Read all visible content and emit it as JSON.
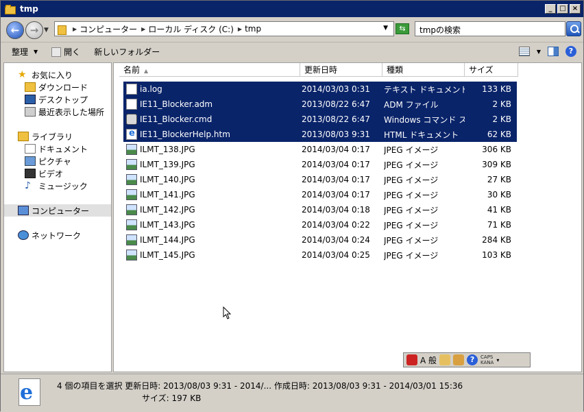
{
  "window": {
    "title": "tmp"
  },
  "address": {
    "crumbs": [
      "コンピューター",
      "ローカル ディスク (C:)",
      "tmp"
    ],
    "search_placeholder": "tmpの検索"
  },
  "toolbar": {
    "organize": "整理",
    "open": "開く",
    "new_folder": "新しいフォルダー"
  },
  "nav": {
    "favorites": "お気に入り",
    "downloads": "ダウンロード",
    "desktop": "デスクトップ",
    "recent": "最近表示した場所",
    "libraries": "ライブラリ",
    "documents": "ドキュメント",
    "pictures": "ピクチャ",
    "videos": "ビデオ",
    "music": "ミュージック",
    "computer": "コンピューター",
    "network": "ネットワーク"
  },
  "columns": {
    "name": "名前",
    "date": "更新日時",
    "type": "種類",
    "size": "サイズ"
  },
  "files": [
    {
      "name": "ia.log",
      "date": "2014/03/03 0:31",
      "type": "テキスト ドキュメント",
      "size": "133 KB",
      "icon": "text-file-icon",
      "selected": true
    },
    {
      "name": "IE11_Blocker.adm",
      "date": "2013/08/22 6:47",
      "type": "ADM ファイル",
      "size": "2 KB",
      "icon": "adm-file-icon",
      "selected": true
    },
    {
      "name": "IE11_Blocker.cmd",
      "date": "2013/08/22 6:47",
      "type": "Windows コマンド ス...",
      "size": "2 KB",
      "icon": "cmd-file-icon",
      "selected": true
    },
    {
      "name": "IE11_BlockerHelp.htm",
      "date": "2013/08/03 9:31",
      "type": "HTML ドキュメント",
      "size": "62 KB",
      "icon": "ie-html-icon",
      "selected": true
    },
    {
      "name": "ILMT_138.JPG",
      "date": "2014/03/04 0:17",
      "type": "JPEG イメージ",
      "size": "306 KB",
      "icon": "jpeg-icon",
      "selected": false
    },
    {
      "name": "ILMT_139.JPG",
      "date": "2014/03/04 0:17",
      "type": "JPEG イメージ",
      "size": "309 KB",
      "icon": "jpeg-icon",
      "selected": false
    },
    {
      "name": "ILMT_140.JPG",
      "date": "2014/03/04 0:17",
      "type": "JPEG イメージ",
      "size": "27 KB",
      "icon": "jpeg-icon",
      "selected": false
    },
    {
      "name": "ILMT_141.JPG",
      "date": "2014/03/04 0:17",
      "type": "JPEG イメージ",
      "size": "30 KB",
      "icon": "jpeg-icon",
      "selected": false
    },
    {
      "name": "ILMT_142.JPG",
      "date": "2014/03/04 0:18",
      "type": "JPEG イメージ",
      "size": "41 KB",
      "icon": "jpeg-icon",
      "selected": false
    },
    {
      "name": "ILMT_143.JPG",
      "date": "2014/03/04 0:22",
      "type": "JPEG イメージ",
      "size": "71 KB",
      "icon": "jpeg-icon",
      "selected": false
    },
    {
      "name": "ILMT_144.JPG",
      "date": "2014/03/04 0:24",
      "type": "JPEG イメージ",
      "size": "284 KB",
      "icon": "jpeg-icon",
      "selected": false
    },
    {
      "name": "ILMT_145.JPG",
      "date": "2014/03/04 0:25",
      "type": "JPEG イメージ",
      "size": "103 KB",
      "icon": "jpeg-icon",
      "selected": false
    }
  ],
  "ime": {
    "mode": "A 般",
    "caps": "CAPS",
    "kana": "KANA"
  },
  "details": {
    "line1": "4 個の項目を選択  更新日時: 2013/08/03 9:31 - 2014/... 作成日時: 2013/08/03 9:31 - 2014/03/01 15:36",
    "line2": "サイズ: 197 KB"
  },
  "colors": {
    "selection": "#0a246a",
    "title_bar": "#0a246a"
  }
}
